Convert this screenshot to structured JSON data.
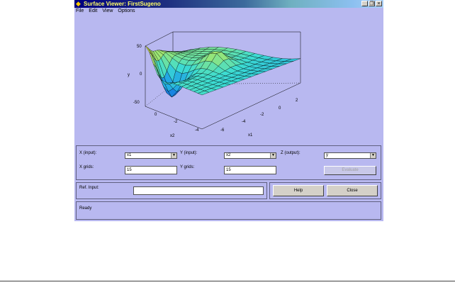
{
  "window": {
    "title": "Surface Viewer: FirstSugeno",
    "controls": [
      "_",
      "❐",
      "×"
    ]
  },
  "menu": [
    "File",
    "Edit",
    "View",
    "Options"
  ],
  "plot": {
    "zlabel": "y",
    "xlabel": "x1",
    "ylabel": "x2",
    "z_ticks": [
      "50",
      "0",
      "-50"
    ],
    "x1_ticks": [
      "-6",
      "-4",
      "-2",
      "0",
      "2"
    ],
    "x2_ticks": [
      "0",
      "-2",
      "-4"
    ]
  },
  "controls": {
    "x_input_label": "X (input):",
    "x_input_value": "x1",
    "y_input_label": "Y (input):",
    "y_input_value": "x2",
    "z_output_label": "Z (output):",
    "z_output_value": "y",
    "x_grids_label": "X grids:",
    "x_grids_value": "15",
    "y_grids_label": "Y grids:",
    "y_grids_value": "15",
    "evaluate_label": "Evaluate",
    "ref_input_label": "Ref. Input:",
    "ref_input_value": "",
    "help_label": "Help",
    "close_label": "Close",
    "status": "Ready"
  },
  "colors": {
    "background": "#b8b8f0",
    "surface_low": "#0a3cd8",
    "surface_high": "#f0f040"
  }
}
